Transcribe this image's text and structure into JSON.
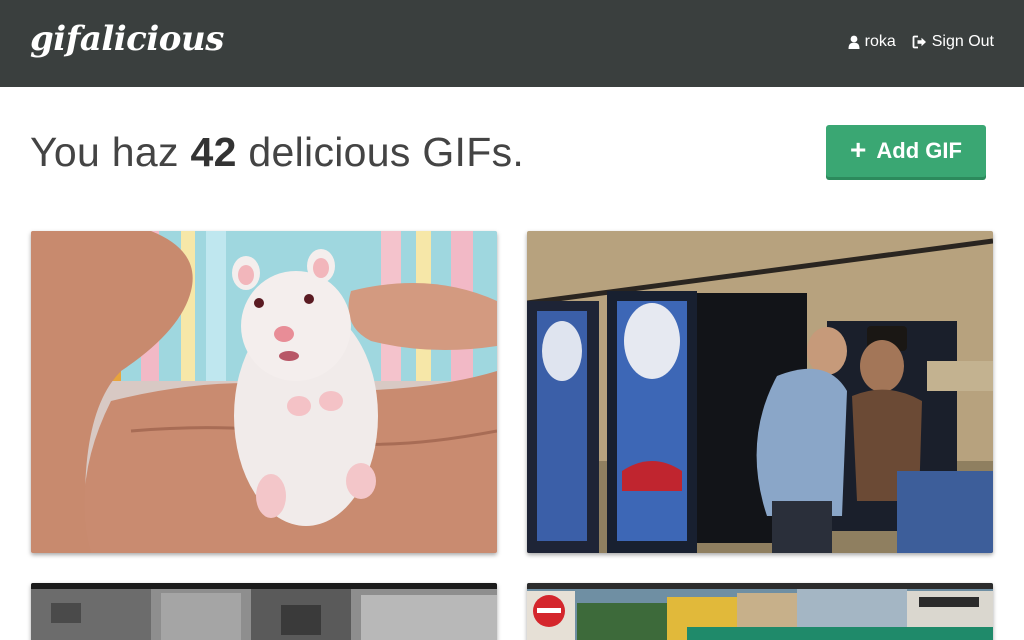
{
  "navbar": {
    "logo": "gifalicious",
    "user_icon": "user-icon",
    "username": "roka",
    "signout_icon": "sign-out-icon",
    "signout_label": "Sign Out"
  },
  "header": {
    "prefix": "You haz",
    "count": "42",
    "suffix": "delicious GIFs.",
    "add_icon": "plus-icon",
    "add_label": "Add GIF"
  },
  "gifs": [
    {
      "name": "hamster-gif"
    },
    {
      "name": "vending-machine-gif"
    },
    {
      "name": "street-gif"
    },
    {
      "name": "construction-gif"
    }
  ],
  "colors": {
    "navbar": "#3a3f3e",
    "accent": "#3aa773",
    "text": "#444444"
  }
}
